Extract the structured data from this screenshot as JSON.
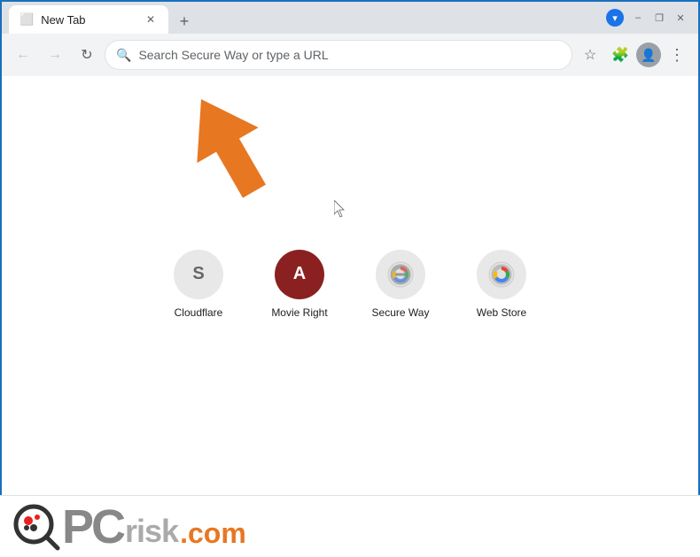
{
  "titlebar": {
    "tab_title": "New Tab",
    "new_tab_label": "+",
    "minimize_label": "–",
    "maximize_label": "❐",
    "close_label": "✕"
  },
  "navbar": {
    "back_label": "←",
    "forward_label": "→",
    "refresh_label": "↻",
    "search_placeholder": "Search Secure Way or type a URL",
    "bookmark_icon": "☆",
    "extensions_icon": "🧩",
    "profile_icon": "👤",
    "more_icon": "⋮"
  },
  "shortcuts": [
    {
      "id": "cloudflare",
      "label": "Cloudflare",
      "letter": "S",
      "type": "letter-gray"
    },
    {
      "id": "movie-right",
      "label": "Movie Right",
      "letter": "A",
      "type": "letter-red"
    },
    {
      "id": "secure-way",
      "label": "Secure Way",
      "letter": "",
      "type": "chrome-minus"
    },
    {
      "id": "web-store",
      "label": "Web Store",
      "letter": "",
      "type": "chrome"
    }
  ],
  "watermark": {
    "text_pc": "PC",
    "text_risk": "risk",
    "text_dotcom": ".com"
  },
  "colors": {
    "border": "#1a6fba",
    "accent_orange": "#e87722",
    "tab_bg": "#dee1e6",
    "nav_bg": "#f1f3f4"
  }
}
